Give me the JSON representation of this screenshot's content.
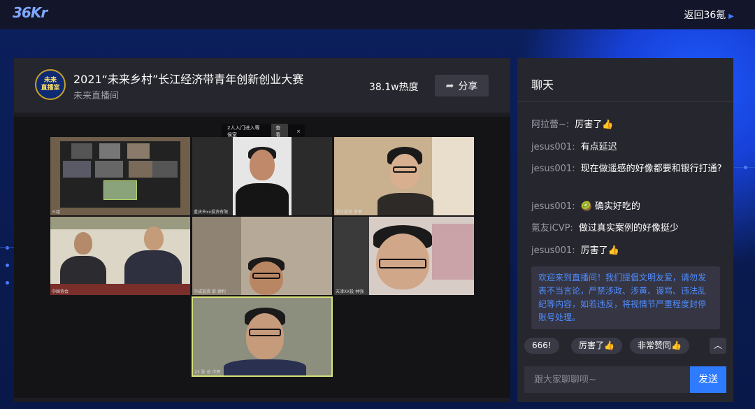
{
  "topbar": {
    "logo_main": "36",
    "logo_tail": "Kr",
    "back_label": "返回36氪",
    "back_icon": "chevron-right-icon"
  },
  "room": {
    "avatar_line1": "未来",
    "avatar_line2": "直播室",
    "title": "2021“未来乡村”长江经济带青年创新创业大赛",
    "subtitle": "未来直播间",
    "heat": "38.1w热度",
    "share_label": "分享"
  },
  "stage": {
    "toast_text": "2人入门进入等候室",
    "toast_button": "查看",
    "toast_close": "×",
    "tiles": [
      {
        "name": "三组"
      },
      {
        "name": "重庆市xx投资有限"
      },
      {
        "name": "浙江投资 李季"
      },
      {
        "name": "中国协会"
      },
      {
        "name": "中成投资 梁 德利"
      },
      {
        "name": "天津XX投 林强"
      },
      {
        "name": "23 张 总 世辉"
      }
    ]
  },
  "chat": {
    "title": "聊天",
    "messages": [
      {
        "user": "阿拉蕾~:",
        "text": "厉害了👍"
      },
      {
        "user": "jesus001:",
        "text": "有点延迟"
      },
      {
        "user": "jesus001:",
        "text": "现在做遥感的好像都要和银行打通?"
      },
      {
        "user": "jesus001:",
        "text": "🥝 确实好吃的"
      },
      {
        "user": "氪友iCVP:",
        "text": "做过真实案例的好像挺少"
      },
      {
        "user": "jesus001:",
        "text": "厉害了👍"
      }
    ],
    "notice": "欢迎来到直播间！我们提倡文明友爱，请勿发表不当言论，严禁涉政、涉黄、谩骂、违法乱纪等内容，如若违反，将视情节严重程度封停账号处理。",
    "quick_replies": [
      "666!",
      "厉害了👍",
      "非常赞同👍"
    ],
    "up_icon": "chevron-up-icon",
    "input_placeholder": "跟大家聊聊呗~",
    "send_label": "发送"
  }
}
